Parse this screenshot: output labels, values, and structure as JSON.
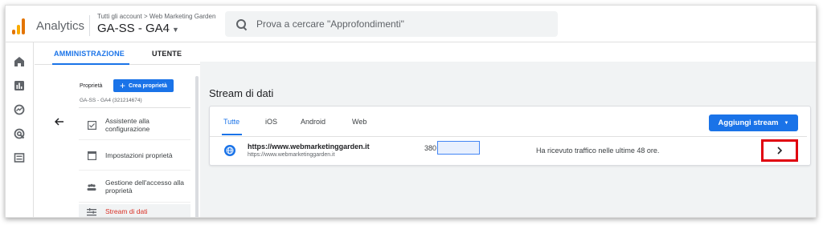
{
  "header": {
    "app_name": "Analytics",
    "breadcrumb": "Tutti gli account > Web Marketing Garden",
    "property": "GA-SS - GA4",
    "search_placeholder": "Prova a cercare \"Approfondimenti\""
  },
  "rail": {
    "icons": [
      "home-icon",
      "reports-icon",
      "explore-icon",
      "advertising-icon",
      "configure-icon"
    ]
  },
  "tabs": [
    {
      "label": "AMMINISTRAZIONE",
      "active": true
    },
    {
      "label": "UTENTE",
      "active": false
    }
  ],
  "property_column": {
    "label": "Proprietà",
    "create_button": "Crea proprietà",
    "property_id": "GA-SS - GA4 (321214674)",
    "items": [
      {
        "label": "Assistente alla configurazione",
        "icon": "checkbox-icon",
        "active": false
      },
      {
        "label": "Impostazioni proprietà",
        "icon": "settings-window-icon",
        "active": false
      },
      {
        "label": "Gestione dell'accesso alla proprietà",
        "icon": "people-icon",
        "active": false
      },
      {
        "label": "Stream di dati",
        "icon": "streams-icon",
        "active": true
      }
    ]
  },
  "main": {
    "title": "Stream di dati",
    "stream_tabs": [
      {
        "label": "Tutte",
        "active": true
      },
      {
        "label": "iOS",
        "active": false
      },
      {
        "label": "Android",
        "active": false
      },
      {
        "label": "Web",
        "active": false
      }
    ],
    "add_stream_button": "Aggiungi stream",
    "streams": [
      {
        "name": "https://www.webmarketinggarden.it",
        "url": "https://www.webmarketinggarden.it",
        "id_prefix": "380",
        "status": "Ha ricevuto traffico nelle ultime 48 ore."
      }
    ]
  },
  "colors": {
    "accent": "#1a73e8",
    "highlight_box": "#e0000f",
    "active_item_text": "#d93025",
    "panel_bg": "#f1f3f4"
  }
}
